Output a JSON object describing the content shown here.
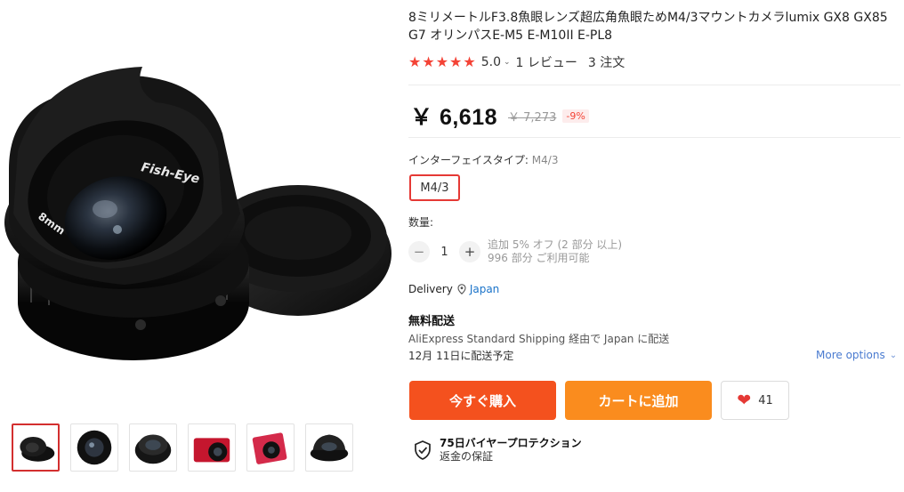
{
  "product": {
    "title": "8ミリメートルF3.8魚眼レンズ超広角魚眼ためM4/3マウントカメラlumix GX8 GX85 G7 オリンパスE-M5 E-M10II E-PL8",
    "rating": "5.0",
    "reviews": "1 レビュー",
    "orders": "3 注文",
    "lens_text": {
      "brand_mark": "Fish-Eye",
      "focal": "8mm"
    }
  },
  "price": {
    "current": "￥ 6,618",
    "original": "￥ 7,273",
    "discount": "-9%"
  },
  "property": {
    "label": "インターフェイスタイプ:",
    "selected": "M4/3",
    "options": [
      "M4/3"
    ]
  },
  "quantity": {
    "label": "数量:",
    "minus": "−",
    "plus": "+",
    "value": "1",
    "bulk_note": "追加 5% オフ (2 部分 以上)",
    "available": "996 部分 ご利用可能"
  },
  "delivery": {
    "label": "Delivery",
    "location": "Japan"
  },
  "shipping": {
    "title": "無料配送",
    "method": "AliExpress Standard Shipping 経由で Japan に配送",
    "date": "12月 11日に配送予定",
    "more_options": "More options"
  },
  "actions": {
    "buy_now": "今すぐ購入",
    "add_to_cart": "カートに追加",
    "wishlist_count": "41"
  },
  "protection": {
    "title": "75日バイヤープロテクション",
    "subtitle": "返金の保証"
  },
  "colors": {
    "accent_red": "#f44336",
    "buy_button": "#f4511e",
    "cart_button": "#fa8c1e",
    "link_blue": "#1a73c9"
  },
  "icons": [
    "star-icon",
    "chevron-down-icon",
    "location-pin-icon",
    "heart-icon",
    "shield-check-icon"
  ]
}
